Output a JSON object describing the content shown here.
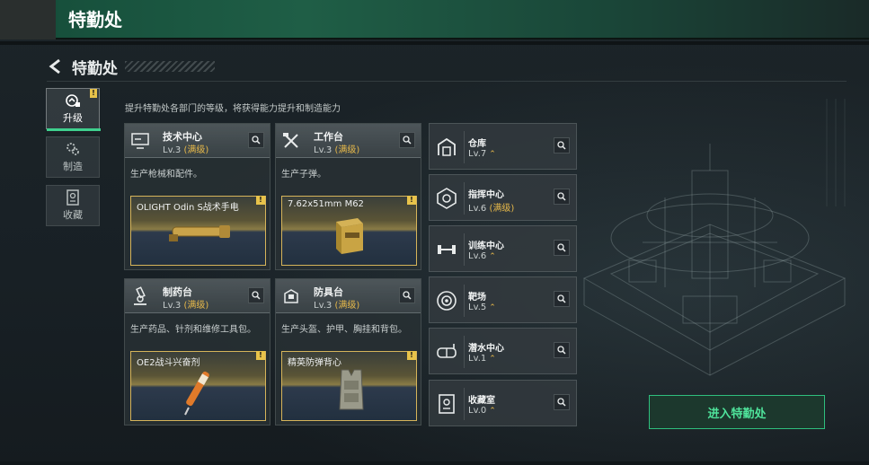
{
  "topbar": {
    "title": "特勤处"
  },
  "header": {
    "title": "特勤处"
  },
  "tabs": [
    {
      "label": "升级",
      "active": true,
      "badge": "!"
    },
    {
      "label": "制造",
      "active": false
    },
    {
      "label": "收藏",
      "active": false
    }
  ],
  "description": "提升特勤处各部门的等级，将获得能力提升和制造能力",
  "cards": [
    {
      "name": "技术中心",
      "level": "Lv.3",
      "max": "(满级)",
      "desc": "生产枪械和配件。",
      "slot_item": "OLIGHT Odin S战术手电",
      "slot_badge": "!",
      "icon": "monitor-icon"
    },
    {
      "name": "工作台",
      "level": "Lv.3",
      "max": "(满级)",
      "desc": "生产子弹。",
      "slot_item": "7.62x51mm M62",
      "slot_badge": "!",
      "icon": "tools-icon"
    },
    {
      "name": "制药台",
      "level": "Lv.3",
      "max": "(满级)",
      "desc": "生产药品、针剂和维修工具包。",
      "slot_item": "OE2战斗兴奋剂",
      "slot_badge": "!",
      "icon": "microscope-icon"
    },
    {
      "name": "防具台",
      "level": "Lv.3",
      "max": "(满级)",
      "desc": "生产头盔、护甲、胸挂和背包。",
      "slot_item": "精英防弹背心",
      "slot_badge": "!",
      "icon": "armor-icon"
    }
  ],
  "facilities": [
    {
      "name": "仓库",
      "level": "Lv.7",
      "max": "",
      "up": "⌃",
      "icon": "warehouse-icon"
    },
    {
      "name": "指挥中心",
      "level": "Lv.6",
      "max": "(满级)",
      "up": "",
      "icon": "command-icon"
    },
    {
      "name": "训练中心",
      "level": "Lv.6",
      "max": "",
      "up": "⌃",
      "icon": "dumbbell-icon"
    },
    {
      "name": "靶场",
      "level": "Lv.5",
      "max": "",
      "up": "⌃",
      "icon": "target-icon"
    },
    {
      "name": "潜水中心",
      "level": "Lv.1",
      "max": "",
      "up": "⌃",
      "icon": "diving-mask-icon"
    },
    {
      "name": "收藏室",
      "level": "Lv.0",
      "max": "",
      "up": "⌃",
      "icon": "collection-icon"
    }
  ],
  "enter_button": "进入特勤处",
  "colors": {
    "accent_green": "#3fd08e",
    "max_gold": "#e7b94a",
    "slot_border": "#d6b45a"
  }
}
